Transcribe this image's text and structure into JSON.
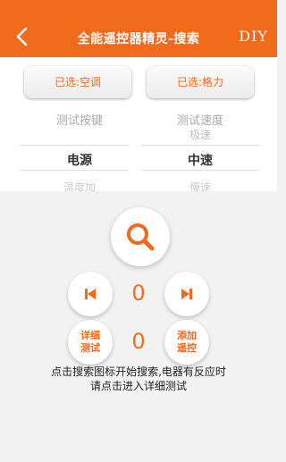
{
  "header": {
    "title": "全能遥控器精灵-搜索",
    "right_action": "DIY"
  },
  "selections": {
    "device": "已选:空调",
    "brand": "已选:格力"
  },
  "picker": {
    "left_header": "测试按键",
    "right_header": "测试速度",
    "right_above": "极速",
    "left_selected": "电源",
    "right_selected": "中速",
    "left_below": "温度加",
    "right_below": "慢速"
  },
  "controls": {
    "key_index": "0",
    "response_count": "0",
    "detail_test_label": "详细\n测试",
    "add_remote_label": "添加\n遥控"
  },
  "hint": {
    "line1": "点击搜索图标开始搜索,电器有反应时",
    "line2": "请点击进入详细测试"
  },
  "colors": {
    "accent": "#f26a1b",
    "header_text": "#ffffff"
  },
  "icons": {
    "back": "back-arrow-icon",
    "search": "search-icon",
    "prev": "skip-previous-icon",
    "next": "skip-next-icon"
  }
}
